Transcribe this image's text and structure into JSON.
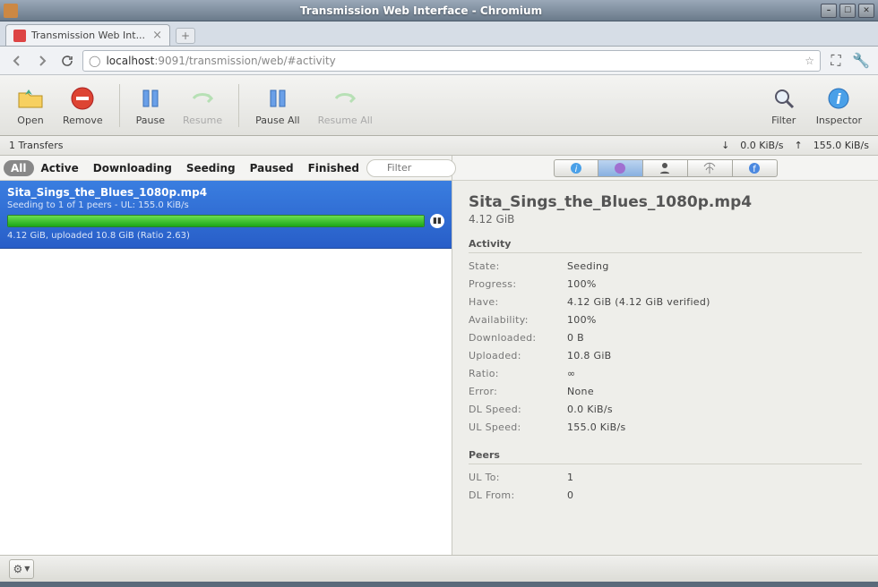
{
  "window": {
    "title": "Transmission Web Interface - Chromium"
  },
  "browser": {
    "tab_title": "Transmission Web Int...",
    "url_prefix": "localhost",
    "url_rest": ":9091/transmission/web/#activity"
  },
  "toolbar": {
    "open": "Open",
    "remove": "Remove",
    "pause": "Pause",
    "resume": "Resume",
    "pause_all": "Pause All",
    "resume_all": "Resume All",
    "filter": "Filter",
    "inspector": "Inspector"
  },
  "status": {
    "transfers": "1 Transfers",
    "dl_speed": "0.0 KiB/s",
    "ul_speed": "155.0 KiB/s"
  },
  "filters": {
    "all": "All",
    "active": "Active",
    "downloading": "Downloading",
    "seeding": "Seeding",
    "paused": "Paused",
    "finished": "Finished",
    "placeholder": "Filter"
  },
  "torrent": {
    "name": "Sita_Sings_the_Blues_1080p.mp4",
    "sub": "Seeding to 1 of 1 peers - UL: 155.0 KiB/s",
    "stats": "4.12 GiB, uploaded 10.8 GiB (Ratio 2.63)"
  },
  "inspector": {
    "title": "Sita_Sings_the_Blues_1080p.mp4",
    "size": "4.12 GiB",
    "activity_header": "Activity",
    "peers_header": "Peers",
    "rows": {
      "state_k": "State:",
      "state_v": "Seeding",
      "progress_k": "Progress:",
      "progress_v": "100%",
      "have_k": "Have:",
      "have_v": "4.12 GiB (4.12 GiB verified)",
      "avail_k": "Availability:",
      "avail_v": "100%",
      "down_k": "Downloaded:",
      "down_v": "0 B",
      "up_k": "Uploaded:",
      "up_v": "10.8 GiB",
      "ratio_k": "Ratio:",
      "ratio_v": "∞",
      "error_k": "Error:",
      "error_v": "None",
      "dls_k": "DL Speed:",
      "dls_v": "0.0 KiB/s",
      "uls_k": "UL Speed:",
      "uls_v": "155.0 KiB/s",
      "ulto_k": "UL To:",
      "ulto_v": "1",
      "dlfrom_k": "DL From:",
      "dlfrom_v": "0"
    }
  }
}
